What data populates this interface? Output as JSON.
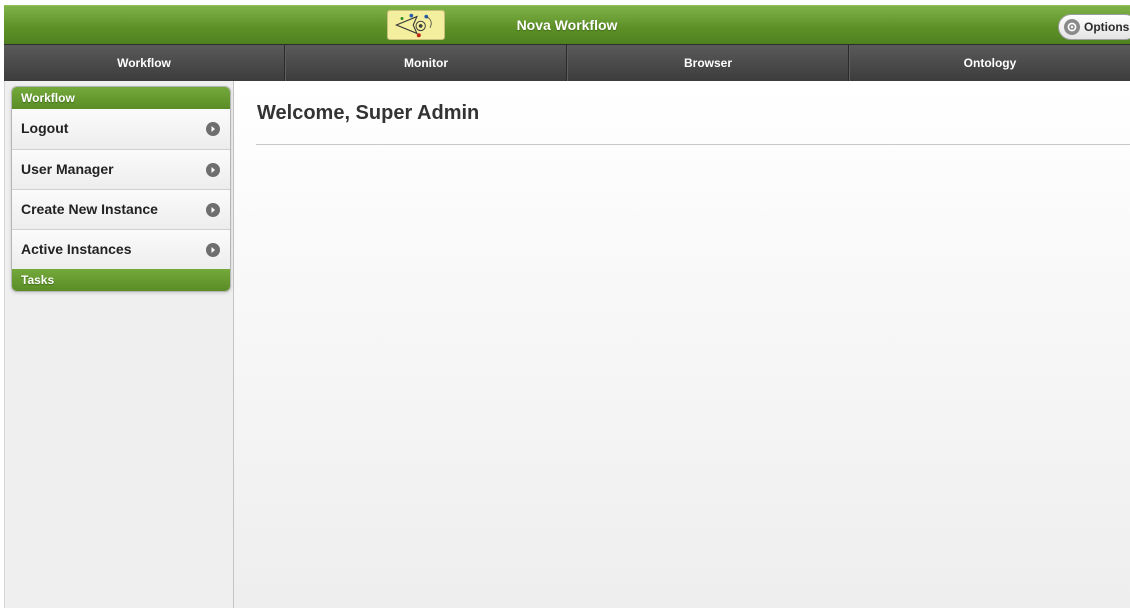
{
  "header": {
    "title": "Nova Workflow",
    "options_label": "Options",
    "logo_icon": "nova-logo-icon",
    "colors": {
      "header_green": "#5f9128",
      "nav_dark": "#3c3c3c"
    }
  },
  "nav": {
    "items": [
      {
        "label": "Workflow"
      },
      {
        "label": "Monitor"
      },
      {
        "label": "Browser"
      },
      {
        "label": "Ontology"
      }
    ]
  },
  "sidebar": {
    "sections": [
      {
        "label": "Workflow"
      },
      {
        "label": "Tasks"
      }
    ],
    "items": [
      {
        "label": "Logout",
        "icon": "chevron-right-icon"
      },
      {
        "label": "User Manager",
        "icon": "chevron-right-icon"
      },
      {
        "label": "Create New Instance",
        "icon": "chevron-right-icon"
      },
      {
        "label": "Active Instances",
        "icon": "chevron-right-icon"
      }
    ]
  },
  "main": {
    "welcome": "Welcome, Super Admin"
  }
}
